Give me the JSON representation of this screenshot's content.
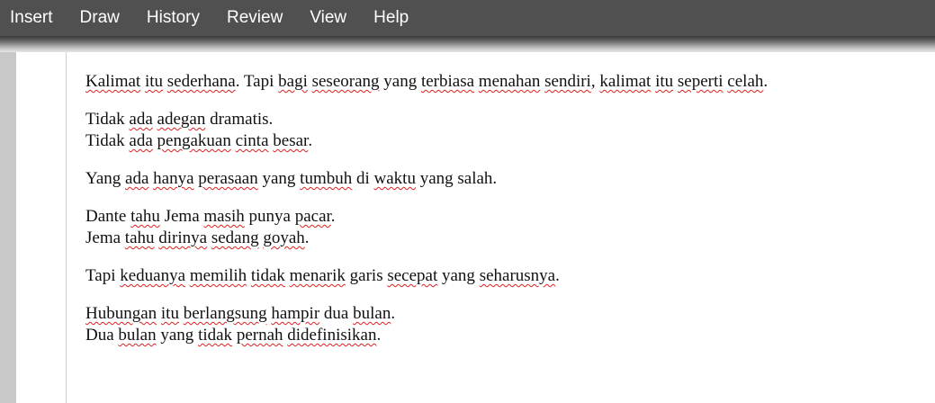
{
  "menu": [
    {
      "label": "Insert"
    },
    {
      "label": "Draw"
    },
    {
      "label": "History"
    },
    {
      "label": "Review"
    },
    {
      "label": "View"
    },
    {
      "label": "Help"
    }
  ],
  "document": {
    "paragraphs": [
      {
        "lines": [
          [
            {
              "t": "Kalimat",
              "s": true
            },
            {
              "t": " "
            },
            {
              "t": "itu",
              "s": true
            },
            {
              "t": " "
            },
            {
              "t": "sederhana",
              "s": true
            },
            {
              "t": ". Tapi "
            },
            {
              "t": "bagi",
              "s": true
            },
            {
              "t": " "
            },
            {
              "t": "seseorang",
              "s": true
            },
            {
              "t": " yang "
            },
            {
              "t": "terbiasa",
              "s": true
            },
            {
              "t": " "
            },
            {
              "t": "menahan",
              "s": true
            },
            {
              "t": " "
            },
            {
              "t": "sendiri",
              "s": true
            },
            {
              "t": ", "
            },
            {
              "t": "kalimat",
              "s": true
            },
            {
              "t": " "
            },
            {
              "t": "itu",
              "s": true
            },
            {
              "t": " "
            },
            {
              "t": "seperti",
              "s": true
            },
            {
              "t": " "
            },
            {
              "t": "celah",
              "s": true
            },
            {
              "t": "."
            }
          ]
        ]
      },
      {
        "lines": [
          [
            {
              "t": "Tidak "
            },
            {
              "t": "ada",
              "s": true
            },
            {
              "t": " "
            },
            {
              "t": "adegan",
              "s": true
            },
            {
              "t": " dramatis."
            }
          ],
          [
            {
              "t": "Tidak "
            },
            {
              "t": "ada",
              "s": true
            },
            {
              "t": " "
            },
            {
              "t": "pengakuan",
              "s": true
            },
            {
              "t": " "
            },
            {
              "t": "cinta",
              "s": true
            },
            {
              "t": " "
            },
            {
              "t": "besar",
              "s": true
            },
            {
              "t": "."
            }
          ]
        ]
      },
      {
        "lines": [
          [
            {
              "t": "Yang "
            },
            {
              "t": "ada",
              "s": true
            },
            {
              "t": " "
            },
            {
              "t": "hanya",
              "s": true
            },
            {
              "t": " "
            },
            {
              "t": "perasaan",
              "s": true
            },
            {
              "t": " yang "
            },
            {
              "t": "tumbuh",
              "s": true
            },
            {
              "t": " di "
            },
            {
              "t": "waktu",
              "s": true
            },
            {
              "t": " yang salah."
            }
          ]
        ]
      },
      {
        "lines": [
          [
            {
              "t": "Dante "
            },
            {
              "t": "tahu",
              "s": true
            },
            {
              "t": " Jema "
            },
            {
              "t": "masih",
              "s": true
            },
            {
              "t": " punya "
            },
            {
              "t": "pacar",
              "s": true
            },
            {
              "t": "."
            }
          ],
          [
            {
              "t": "Jema "
            },
            {
              "t": "tahu",
              "s": true
            },
            {
              "t": " "
            },
            {
              "t": "dirinya",
              "s": true
            },
            {
              "t": " "
            },
            {
              "t": "sedang",
              "s": true
            },
            {
              "t": " "
            },
            {
              "t": "goyah",
              "s": true
            },
            {
              "t": "."
            }
          ]
        ]
      },
      {
        "lines": [
          [
            {
              "t": "Tapi "
            },
            {
              "t": "keduanya",
              "s": true
            },
            {
              "t": " "
            },
            {
              "t": "memilih",
              "s": true
            },
            {
              "t": " "
            },
            {
              "t": "tidak",
              "s": true
            },
            {
              "t": " "
            },
            {
              "t": "menarik",
              "s": true
            },
            {
              "t": " garis "
            },
            {
              "t": "secepat",
              "s": true
            },
            {
              "t": " yang "
            },
            {
              "t": "seharusnya",
              "s": true
            },
            {
              "t": "."
            }
          ]
        ]
      },
      {
        "lines": [
          [
            {
              "t": "Hubungan",
              "s": true
            },
            {
              "t": " "
            },
            {
              "t": "itu",
              "s": true
            },
            {
              "t": " "
            },
            {
              "t": "berlangsung",
              "s": true
            },
            {
              "t": " "
            },
            {
              "t": "hampir",
              "s": true
            },
            {
              "t": " dua "
            },
            {
              "t": "bulan",
              "s": true
            },
            {
              "t": "."
            }
          ],
          [
            {
              "t": "Dua "
            },
            {
              "t": "bulan",
              "s": true
            },
            {
              "t": " yang "
            },
            {
              "t": "tidak",
              "s": true
            },
            {
              "t": " "
            },
            {
              "t": "pernah",
              "s": true
            },
            {
              "t": " "
            },
            {
              "t": "didefinisikan",
              "s": true
            },
            {
              "t": "."
            }
          ]
        ]
      }
    ]
  }
}
